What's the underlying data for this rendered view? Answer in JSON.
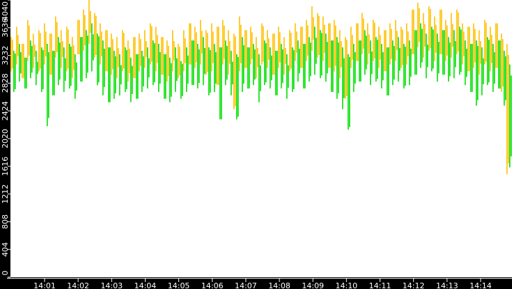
{
  "chart_data": {
    "type": "bar",
    "title": "",
    "xlabel": "",
    "ylabel": "",
    "ylim": [
      0,
      4040
    ],
    "yticks": [
      "0",
      "404",
      "808",
      "1212",
      "1616",
      "2020",
      "2424",
      "2828",
      "3232",
      "3636",
      "4040"
    ],
    "xticks": [
      "14:01",
      "14:02",
      "14:03",
      "14:04",
      "14:05",
      "14:06",
      "14:07",
      "14:08",
      "14:09",
      "14:10",
      "14:11",
      "14:12",
      "14:13",
      "14:14"
    ],
    "x_range_minutes": [
      0,
      15
    ],
    "sample_interval_seconds": 10,
    "grid": false,
    "series": [
      {
        "name": "orange",
        "color": "#ffc000",
        "high": [
          3500,
          3650,
          3400,
          3750,
          3550,
          3600,
          3700,
          3550,
          3800,
          3600,
          3650,
          3500,
          3750,
          3900,
          4040,
          3850,
          3700,
          3600,
          3550,
          3500,
          3600,
          3450,
          3500,
          3550,
          3600,
          3700,
          3650,
          3500,
          3450,
          3600,
          3400,
          3600,
          3700,
          3650,
          3750,
          3600,
          3700,
          3650,
          3750,
          3600,
          3550,
          3800,
          3600,
          3650,
          3500,
          3700,
          3600,
          3550,
          3650,
          3500,
          3600,
          3700,
          3650,
          3750,
          3950,
          3850,
          3800,
          3700,
          3750,
          3600,
          3500,
          3650,
          3700,
          3850,
          3700,
          3750,
          3650,
          3600,
          3700,
          3750,
          3650,
          3700,
          3900,
          4000,
          3850,
          3950,
          3800,
          3900,
          3750,
          3850,
          3900,
          3700,
          3650,
          3700,
          3600,
          3750,
          3650,
          3700,
          3550,
          3400
        ],
        "low": [
          3000,
          3100,
          2900,
          3150,
          3050,
          3000,
          3100,
          2950,
          3200,
          3050,
          3000,
          2900,
          3250,
          3300,
          3400,
          3200,
          3100,
          3000,
          2950,
          2900,
          3000,
          2850,
          2900,
          3000,
          3050,
          3100,
          3000,
          2950,
          2850,
          3000,
          2900,
          3000,
          3100,
          3050,
          3100,
          2950,
          3000,
          2800,
          3100,
          2950,
          2450,
          3000,
          3050,
          3100,
          2900,
          3100,
          3050,
          2950,
          3050,
          2950,
          3000,
          3150,
          3050,
          3150,
          3300,
          3200,
          3150,
          3050,
          3000,
          2900,
          2600,
          3050,
          3150,
          3250,
          3100,
          3150,
          3050,
          3000,
          3100,
          3150,
          3050,
          3100,
          3250,
          3350,
          3200,
          3300,
          3150,
          3250,
          3150,
          3200,
          3250,
          3100,
          3000,
          3050,
          2950,
          3100,
          3000,
          3050,
          2700,
          1500
        ]
      },
      {
        "name": "green",
        "color": "#00e000",
        "high": [
          3300,
          3400,
          3200,
          3450,
          3300,
          3350,
          3400,
          3300,
          3500,
          3350,
          3400,
          3250,
          3500,
          3600,
          3700,
          3550,
          3450,
          3350,
          3300,
          3250,
          3350,
          3200,
          3250,
          3300,
          3350,
          3450,
          3400,
          3250,
          3200,
          3350,
          3150,
          3350,
          3450,
          3400,
          3500,
          3350,
          3400,
          3350,
          3450,
          3300,
          3250,
          3500,
          3350,
          3400,
          3250,
          3450,
          3350,
          3300,
          3400,
          3250,
          3350,
          3450,
          3400,
          3500,
          3650,
          3600,
          3550,
          3450,
          3500,
          3350,
          3250,
          3400,
          3450,
          3600,
          3450,
          3500,
          3400,
          3350,
          3450,
          3500,
          3400,
          3450,
          3600,
          3700,
          3550,
          3650,
          3550,
          3600,
          3500,
          3600,
          3650,
          3450,
          3400,
          3450,
          3350,
          3500,
          3400,
          3450,
          3300,
          3100
        ],
        "low": [
          2700,
          2850,
          2750,
          2900,
          2800,
          2700,
          2200,
          2650,
          2800,
          2700,
          2750,
          2600,
          2850,
          2900,
          3000,
          2800,
          2650,
          2550,
          2600,
          2650,
          2700,
          2550,
          2600,
          2700,
          2750,
          2800,
          2700,
          2600,
          2550,
          2700,
          2600,
          2700,
          2800,
          2750,
          2800,
          2650,
          2700,
          2300,
          2800,
          2650,
          2300,
          2700,
          2750,
          2800,
          2550,
          2800,
          2750,
          2650,
          2750,
          2600,
          2700,
          2850,
          2750,
          2850,
          2950,
          2900,
          2850,
          2700,
          2600,
          2450,
          2150,
          2700,
          2850,
          2950,
          2800,
          2850,
          2750,
          2650,
          2800,
          2850,
          2750,
          2800,
          2950,
          3050,
          2900,
          3000,
          2850,
          2950,
          2850,
          2900,
          2950,
          2800,
          2700,
          2500,
          2650,
          2800,
          2700,
          2750,
          2500,
          1600
        ]
      }
    ]
  }
}
